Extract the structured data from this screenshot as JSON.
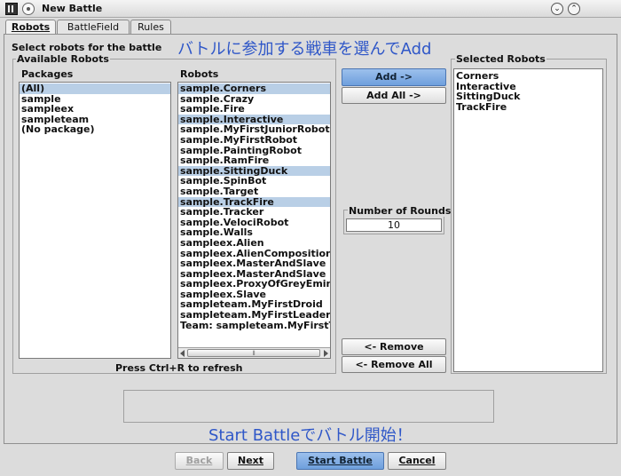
{
  "window": {
    "title": "New Battle",
    "minimize_glyph": "⌄",
    "maximize_glyph": "⌃"
  },
  "tabs": [
    {
      "label": "Robots",
      "active": true
    },
    {
      "label": "BattleField",
      "active": false
    },
    {
      "label": "Rules",
      "active": false
    }
  ],
  "robots_tab": {
    "instruction": "Select robots for the battle",
    "annotation_top": "バトルに参加する戦車を選んでAdd",
    "available_group_title": "Available Robots",
    "packages_header": "Packages",
    "robots_header": "Robots",
    "packages": [
      "(All)",
      "sample",
      "sampleex",
      "sampleteam",
      "(No package)"
    ],
    "packages_selected_index": 0,
    "robots": [
      "sample.Corners",
      "sample.Crazy",
      "sample.Fire",
      "sample.Interactive",
      "sample.MyFirstJuniorRobot",
      "sample.MyFirstRobot",
      "sample.PaintingRobot",
      "sample.RamFire",
      "sample.SittingDuck",
      "sample.SpinBot",
      "sample.Target",
      "sample.TrackFire",
      "sample.Tracker",
      "sample.VelociRobot",
      "sample.Walls",
      "sampleex.Alien",
      "sampleex.AlienComposition",
      "sampleex.MasterAndSlave",
      "sampleex.MasterAndSlave",
      "sampleex.ProxyOfGreyEminer",
      "sampleex.Slave",
      "sampleteam.MyFirstDroid",
      "sampleteam.MyFirstLeader",
      "Team: sampleteam.MyFirstTe"
    ],
    "robots_selected_indices": [
      0,
      3,
      8,
      11
    ],
    "refresh_hint": "Press Ctrl+R to refresh",
    "add_button": "Add ->",
    "add_all_button": "Add All ->",
    "rounds_label": "Number of Rounds",
    "rounds_value": "10",
    "remove_button": "<- Remove",
    "remove_all_button": "<- Remove All",
    "selected_group_title": "Selected Robots",
    "selected_robots": [
      "Corners",
      "Interactive",
      "SittingDuck",
      "TrackFire"
    ],
    "annotation_bottom": "Start Battleでバトル開始！",
    "scrollbar_grip": "⦀"
  },
  "footer": {
    "back_button": "Back",
    "next_button": "Next",
    "start_button": "Start Battle",
    "cancel_button": "Cancel"
  }
}
